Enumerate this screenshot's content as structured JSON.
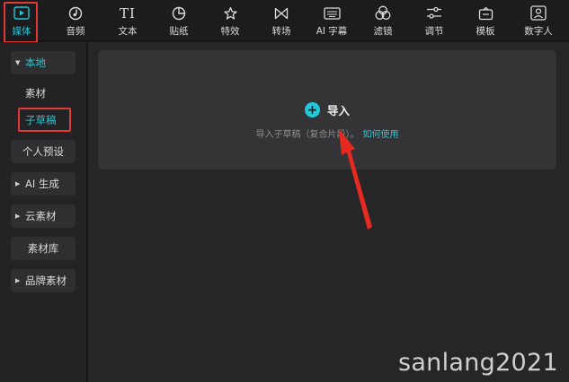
{
  "toolbar": {
    "items": [
      {
        "label": "媒体",
        "icon": "media-play-icon",
        "active": true
      },
      {
        "label": "音频",
        "icon": "music-note-icon"
      },
      {
        "label": "文本",
        "icon": "text-ti-icon"
      },
      {
        "label": "贴纸",
        "icon": "sticker-icon"
      },
      {
        "label": "特效",
        "icon": "effects-star-icon"
      },
      {
        "label": "转场",
        "icon": "transition-bowtie-icon"
      },
      {
        "label": "AI 字幕",
        "icon": "keyboard-icon"
      },
      {
        "label": "滤镜",
        "icon": "filter-circles-icon"
      },
      {
        "label": "调节",
        "icon": "sliders-icon"
      },
      {
        "label": "模板",
        "icon": "template-icon"
      },
      {
        "label": "数字人",
        "icon": "digital-human-icon"
      }
    ],
    "text_icon_glyph": "TI"
  },
  "sidebar": {
    "items": [
      {
        "label": "本地",
        "expanded": true
      },
      {
        "label": "素材"
      },
      {
        "label": "子草稿",
        "active": true
      },
      {
        "label": "个人预设"
      },
      {
        "label": "AI 生成",
        "collapsed": true
      },
      {
        "label": "云素材",
        "collapsed": true
      },
      {
        "label": "素材库"
      },
      {
        "label": "品牌素材",
        "collapsed": true
      }
    ]
  },
  "main": {
    "import_label": "导入",
    "hint_text": "导入子草稿（复合片段）。",
    "hint_link": "如何使用"
  },
  "watermark": "sanlang2021",
  "colors": {
    "accent": "#22c8d7",
    "annotation_red": "#e23b35",
    "background": "#1b1b1d"
  }
}
